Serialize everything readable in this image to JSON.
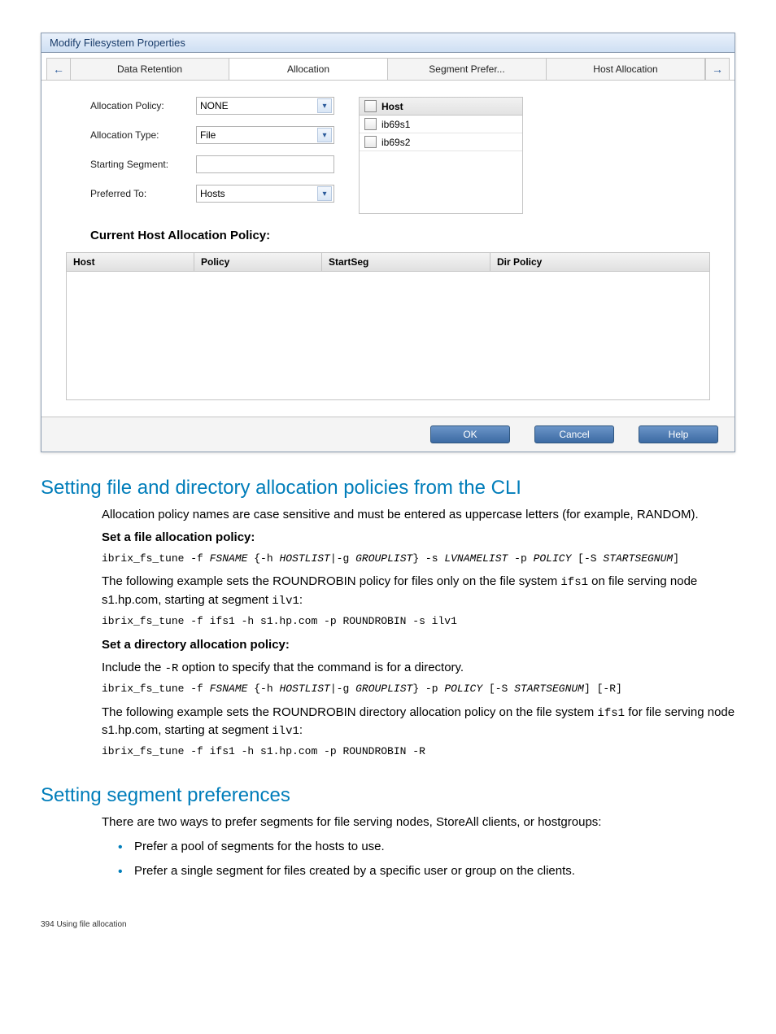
{
  "dialog": {
    "title": "Modify Filesystem Properties",
    "tabs": [
      "Data Retention",
      "Allocation",
      "Segment Prefer...",
      "Host Allocation"
    ],
    "form": {
      "allocPolicyLabel": "Allocation Policy:",
      "allocPolicyValue": "NONE",
      "allocTypeLabel": "Allocation Type:",
      "allocTypeValue": "File",
      "startSegLabel": "Starting Segment:",
      "startSegValue": "",
      "preferredLabel": "Preferred To:",
      "preferredValue": "Hosts"
    },
    "hosts": {
      "header": "Host",
      "items": [
        "ib69s1",
        "ib69s2"
      ]
    },
    "sectionTitle": "Current Host Allocation Policy:",
    "tableHeaders": {
      "host": "Host",
      "policy": "Policy",
      "startSeg": "StartSeg",
      "dirPolicy": "Dir Policy"
    },
    "buttons": {
      "ok": "OK",
      "cancel": "Cancel",
      "help": "Help"
    }
  },
  "doc": {
    "h1": "Setting file and directory allocation policies from the CLI",
    "p1": "Allocation policy names are case sensitive and must be entered as uppercase letters (for example, RANDOM).",
    "setFile": "Set a file allocation policy:",
    "p2a": "The following example sets the ROUNDROBIN policy for files only on the file system ",
    "p2code1": "ifs1",
    "p2b": " on file serving node s1.hp.com, starting at segment ",
    "p2code2": "ilv1",
    "p2c": ":",
    "cmd2": "ibrix_fs_tune -f ifs1 -h s1.hp.com -p ROUNDROBIN -s ilv1",
    "setDir": "Set a directory allocation policy:",
    "p3a": "Include the ",
    "p3code": "-R",
    "p3b": " option to specify that the command is for a directory.",
    "p4a": "The following example sets the ROUNDROBIN directory allocation policy on the file system ",
    "p4code1": "ifs1",
    "p4b": " for file serving node s1.hp.com, starting at segment ",
    "p4code2": "ilv1",
    "p4c": ":",
    "cmd4": "ibrix_fs_tune -f ifs1 -h s1.hp.com -p ROUNDROBIN -R",
    "h2": "Setting segment preferences",
    "p5": "There are two ways to prefer segments for file serving nodes, StoreAll clients, or hostgroups:",
    "b1": "Prefer a pool of segments for the hosts to use.",
    "b2": "Prefer a single segment for files created by a specific user or group on the clients.",
    "footer": "394   Using file allocation"
  }
}
